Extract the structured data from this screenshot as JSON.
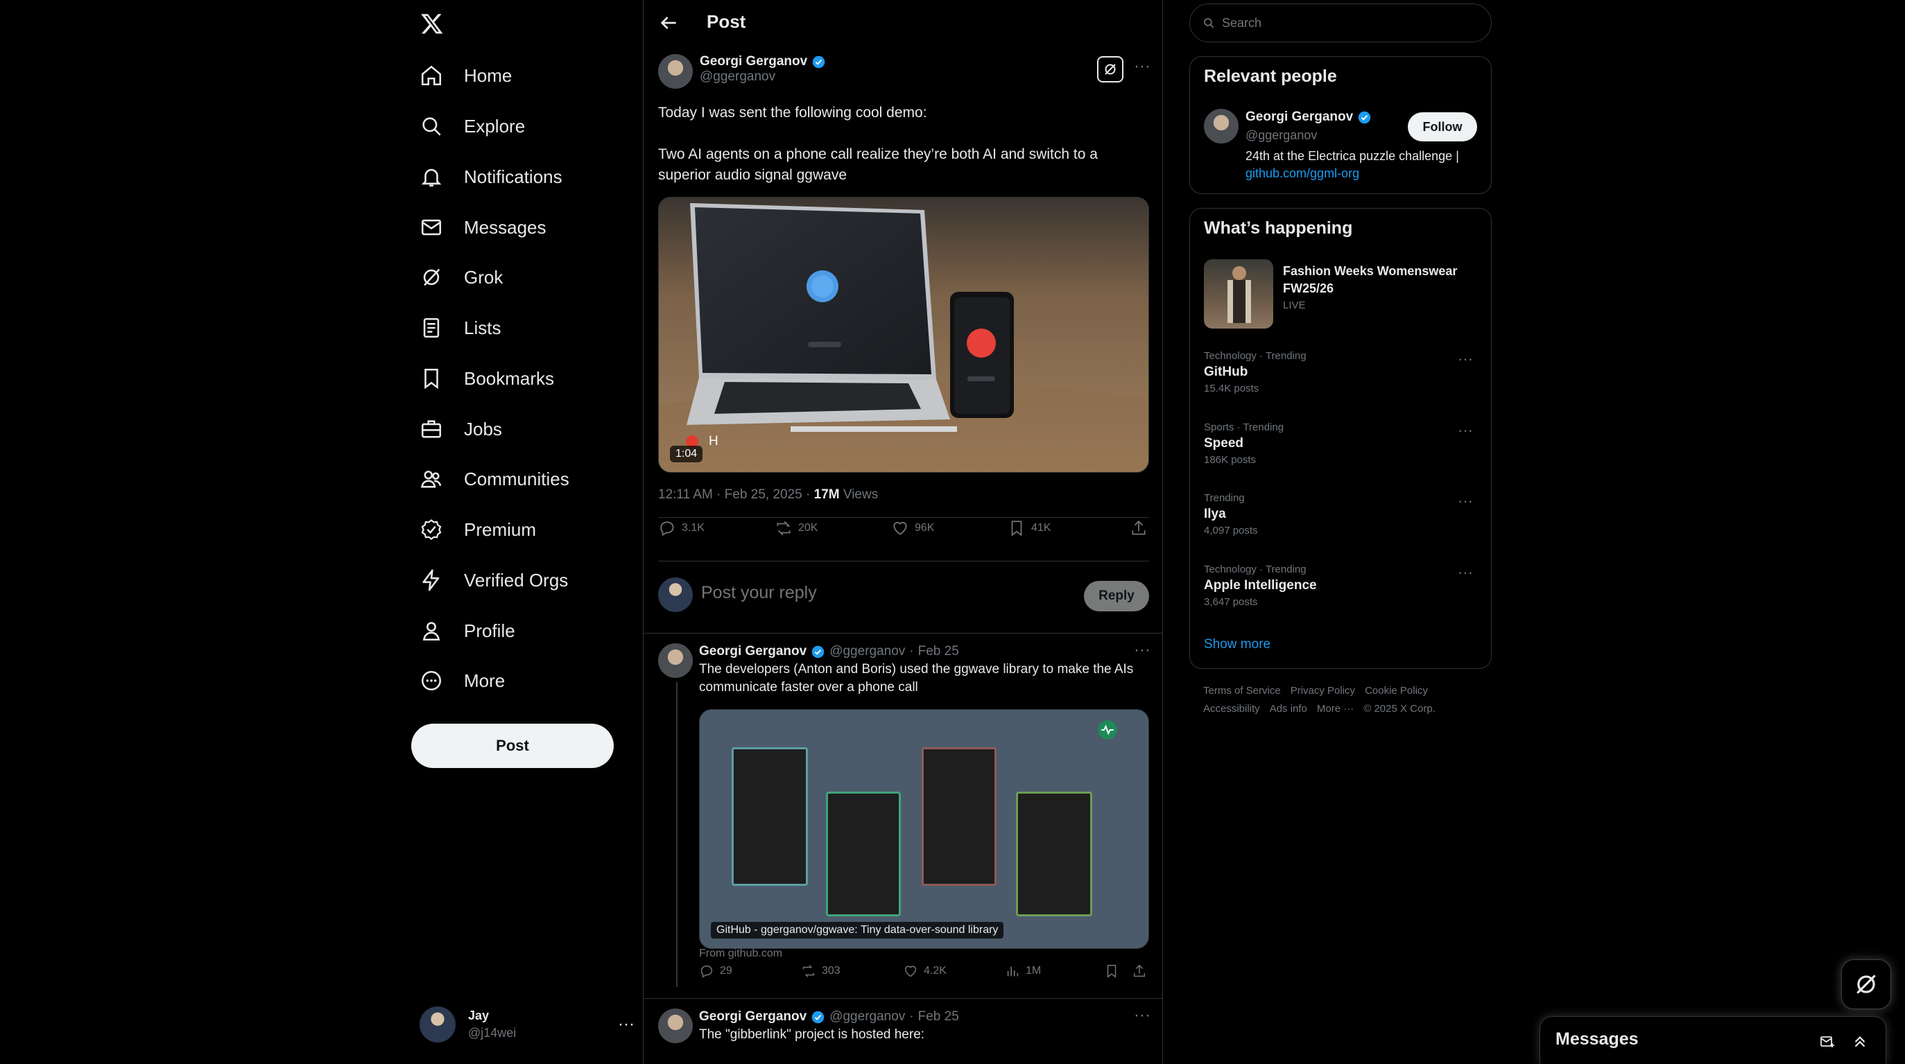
{
  "nav": {
    "items": [
      {
        "label": "Home",
        "icon": "home-icon"
      },
      {
        "label": "Explore",
        "icon": "search-icon"
      },
      {
        "label": "Notifications",
        "icon": "bell-icon"
      },
      {
        "label": "Messages",
        "icon": "mail-icon"
      },
      {
        "label": "Grok",
        "icon": "grok-icon"
      },
      {
        "label": "Lists",
        "icon": "list-icon"
      },
      {
        "label": "Bookmarks",
        "icon": "bookmark-icon"
      },
      {
        "label": "Jobs",
        "icon": "briefcase-icon"
      },
      {
        "label": "Communities",
        "icon": "people-icon"
      },
      {
        "label": "Premium",
        "icon": "premium-icon"
      },
      {
        "label": "Verified Orgs",
        "icon": "lightning-icon"
      },
      {
        "label": "Profile",
        "icon": "person-icon"
      },
      {
        "label": "More",
        "icon": "more-circle-icon"
      }
    ],
    "post_button": "Post",
    "account": {
      "name": "Jay",
      "handle": "@j14wei"
    }
  },
  "main": {
    "header_title": "Post",
    "post": {
      "author": "Georgi Gerganov",
      "handle": "@ggerganov",
      "text1": "Today I was sent the following cool demo:",
      "text2": "Two AI agents on a phone call realize they’re both AI and switch to a superior audio signal ggwave",
      "video_duration": "1:04",
      "video_caption_letter": "H",
      "timestamp": "12:11 AM · Feb 25, 2025 · ",
      "views_count": "17M",
      "views_label": " Views",
      "replies": "3.1K",
      "reposts": "20K",
      "likes": "96K",
      "bookmarks": "41K"
    },
    "reply_box": {
      "placeholder": "Post your reply",
      "button": "Reply"
    },
    "replies": [
      {
        "author": "Georgi Gerganov",
        "handle": "@ggerganov",
        "date": "Feb 25",
        "text": "The developers (Anton and Boris) used the ggwave library to make the AIs communicate faster over a phone call",
        "card_label": "GitHub - ggerganov/ggwave: Tiny data-over-sound library",
        "card_source": "From github.com",
        "replies": "29",
        "reposts": "303",
        "likes": "4.2K",
        "views": "1M"
      },
      {
        "author": "Georgi Gerganov",
        "handle": "@ggerganov",
        "date": "Feb 25",
        "text": "The \"gibberlink\" project is hosted here:"
      }
    ]
  },
  "right": {
    "search_placeholder": "Search",
    "relevant": {
      "title": "Relevant people",
      "name": "Georgi Gerganov",
      "handle": "@ggerganov",
      "bio": "24th at the Electrica puzzle challenge |",
      "bio_link": "github.com/ggml-org",
      "follow": "Follow"
    },
    "happening": {
      "title": "What’s happening",
      "event": {
        "title": "Fashion Weeks Womenswear FW25/26",
        "status": "LIVE"
      },
      "trends": [
        {
          "context": "Technology · Trending",
          "name": "GitHub",
          "count": "15.4K posts"
        },
        {
          "context": "Sports · Trending",
          "name": "Speed",
          "count": "186K posts"
        },
        {
          "context": "Trending",
          "name": "Ilya",
          "count": "4,097 posts"
        },
        {
          "context": "Technology · Trending",
          "name": "Apple Intelligence",
          "count": "3,647 posts"
        }
      ],
      "show_more": "Show more"
    },
    "footer": {
      "links": [
        "Terms of Service",
        "Privacy Policy",
        "Cookie Policy",
        "Accessibility",
        "Ads info",
        "More ···"
      ],
      "copyright": "© 2025 X Corp."
    }
  },
  "messages_drawer": {
    "title": "Messages"
  },
  "colors": {
    "accent": "#1d9bf0",
    "background": "#000000",
    "border": "#2f3336",
    "muted": "#71767b"
  }
}
